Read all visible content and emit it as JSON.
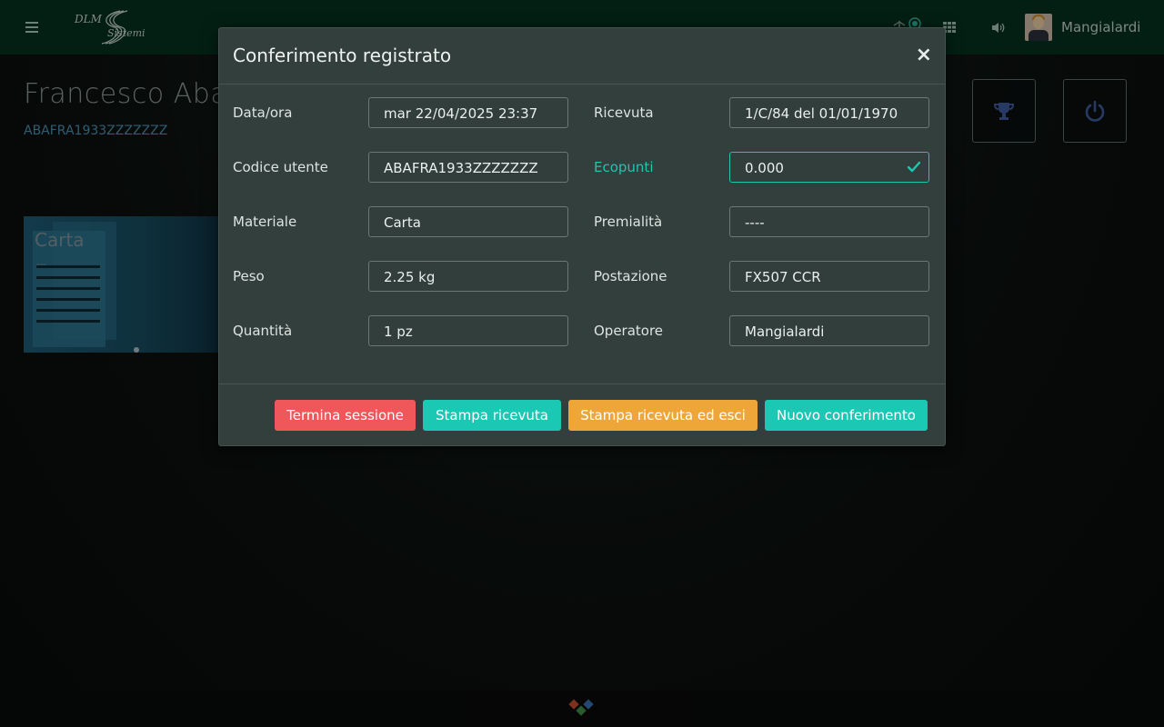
{
  "navbar": {
    "logo_line1": "DLM",
    "logo_line2": "Sistemi",
    "username": "Mangialardi"
  },
  "background": {
    "user_name": "Francesco Abat",
    "user_code": "ABAFRA1933ZZZZZZZ",
    "card_title": "Carta",
    "card_subtitle": "---"
  },
  "modal": {
    "title": "Conferimento registrato",
    "close_label": "×",
    "fields": {
      "data_ora": {
        "label": "Data/ora",
        "value": "mar 22/04/2025 23:37"
      },
      "ricevuta": {
        "label": "Ricevuta",
        "value": "1/C/84 del 01/01/1970"
      },
      "codice_utente": {
        "label": "Codice utente",
        "value": "ABAFRA1933ZZZZZZZ"
      },
      "ecopunti": {
        "label": "Ecopunti",
        "value": "0.000"
      },
      "materiale": {
        "label": "Materiale",
        "value": "Carta"
      },
      "premialita": {
        "label": "Premialità",
        "value": "----"
      },
      "peso": {
        "label": "Peso",
        "value": "2.25 kg"
      },
      "postazione": {
        "label": "Postazione",
        "value": "FX507 CCR"
      },
      "quantita": {
        "label": "Quantità",
        "value": "1 pz"
      },
      "operatore": {
        "label": "Operatore",
        "value": "Mangialardi"
      }
    },
    "buttons": {
      "termina": "Termina sessione",
      "stampa": "Stampa ricevuta",
      "stampa_esci": "Stampa ricevuta ed esci",
      "nuovo": "Nuovo conferimento"
    }
  },
  "colors": {
    "navbar": "#06301f",
    "modal_bg": "#333f3c",
    "accent_teal": "#1ac8b3",
    "danger": "#f0575a",
    "warning": "#efa638"
  }
}
